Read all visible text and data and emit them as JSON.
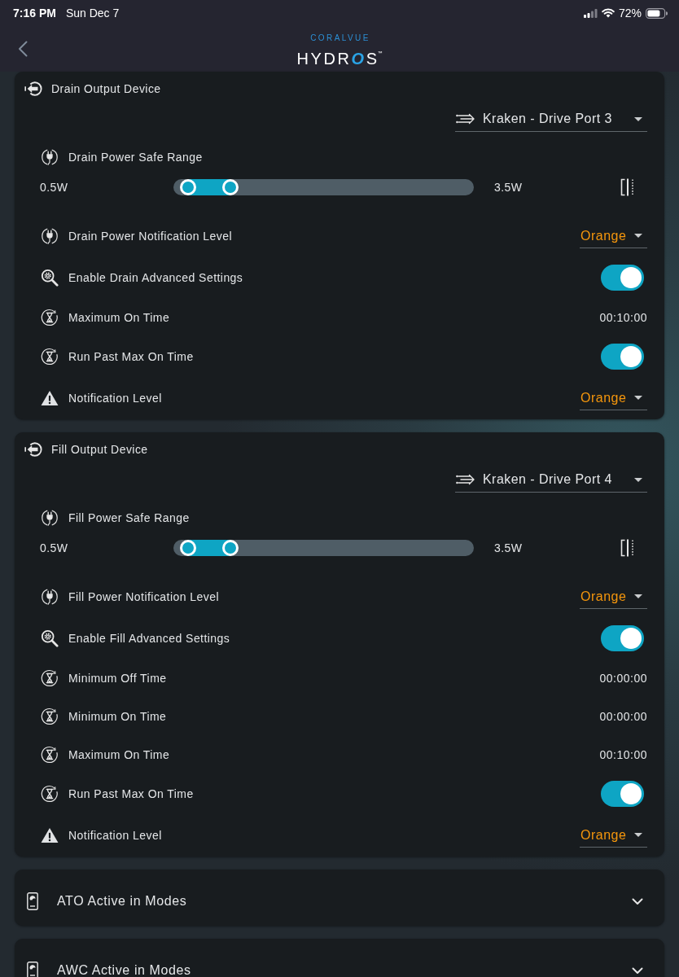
{
  "status_bar": {
    "time": "7:16 PM",
    "date": "Sun Dec 7",
    "battery": "72%"
  },
  "nav": {
    "logo": {
      "tagline": "CORALVUE",
      "name": "HYDROS",
      "mark": "™"
    }
  },
  "sections": [
    {
      "kind": "output",
      "title": "Drain Output Device",
      "device": "Kraken - Drive Port 3",
      "safe_range": {
        "label": "Drain Power Safe Range",
        "min_label": "0.5W",
        "max_label": "3.5W",
        "thumbs": [
          {
            "level": 0.05
          },
          {
            "level": 0.19
          }
        ]
      },
      "settings": [
        {
          "kind": "power",
          "label": "Drain Power Notification Level",
          "select": "Orange"
        },
        {
          "kind": "advanced",
          "label": "Enable Drain Advanced Settings",
          "on": true
        },
        {
          "kind": "timer",
          "label": "Maximum On Time",
          "reading": "00:10:00"
        },
        {
          "kind": "timer",
          "label": "Run Past Max On Time",
          "on": true
        },
        {
          "kind": "alert",
          "label": "Notification Level",
          "select": "Orange"
        }
      ]
    },
    {
      "kind": "output",
      "title": "Fill Output Device",
      "device": "Kraken - Drive Port 4",
      "safe_range": {
        "label": "Fill Power Safe Range",
        "min_label": "0.5W",
        "max_label": "3.5W",
        "thumbs": [
          {
            "level": 0.05
          },
          {
            "level": 0.19
          }
        ]
      },
      "settings": [
        {
          "kind": "power",
          "label": "Fill Power Notification Level",
          "select": "Orange"
        },
        {
          "kind": "advanced",
          "label": "Enable Fill Advanced Settings",
          "on": true
        },
        {
          "kind": "timer",
          "label": "Minimum Off Time",
          "reading": "00:00:00"
        },
        {
          "kind": "timer",
          "label": "Minimum On Time",
          "reading": "00:00:00"
        },
        {
          "kind": "timer",
          "label": "Maximum On Time",
          "reading": "00:10:00"
        },
        {
          "kind": "timer",
          "label": "Run Past Max On Time",
          "on": true
        },
        {
          "kind": "alert",
          "label": "Notification Level",
          "select": "Orange"
        }
      ]
    },
    {
      "kind": "modes",
      "title": "ATO Active in Modes",
      "expanded": false
    },
    {
      "kind": "modes",
      "title": "AWC Active in Modes",
      "expanded": false
    }
  ]
}
